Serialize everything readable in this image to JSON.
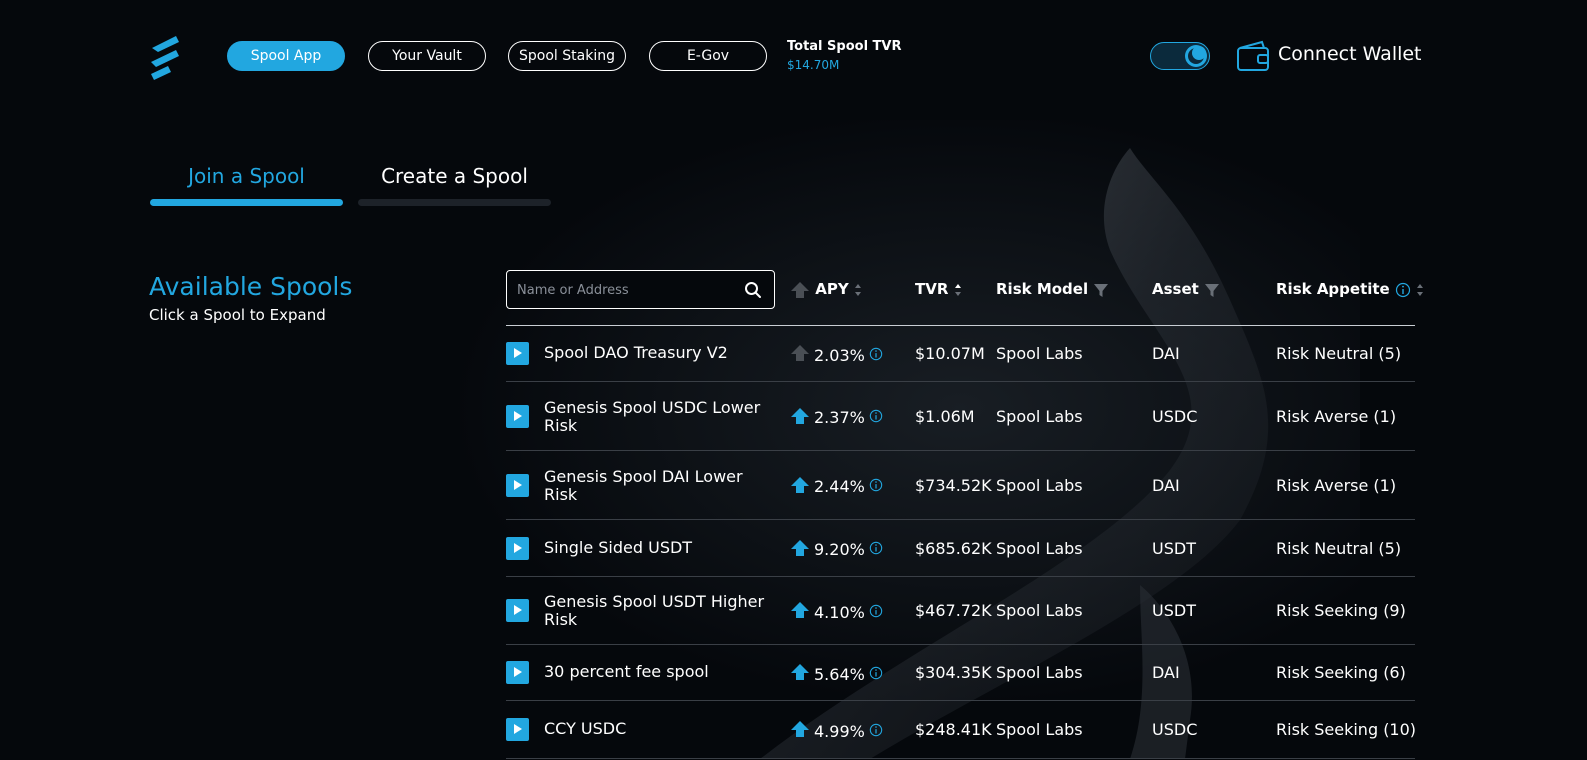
{
  "nav": {
    "items": [
      {
        "label": "Spool App",
        "active": true
      },
      {
        "label": "Your Vault",
        "active": false
      },
      {
        "label": "Spool Staking",
        "active": false
      },
      {
        "label": "E-Gov",
        "active": false
      }
    ],
    "tvr_label": "Total Spool TVR",
    "tvr_value": "$14.70M",
    "connect_wallet": "Connect Wallet"
  },
  "tabs": {
    "join": "Join a Spool",
    "create": "Create a Spool"
  },
  "available": {
    "title": "Available Spools",
    "subtitle": "Click a Spool to Expand"
  },
  "search": {
    "placeholder": "Name or Address"
  },
  "table": {
    "headers": {
      "apy": "APY",
      "tvr": "TVR",
      "risk_model": "Risk Model",
      "asset": "Asset",
      "risk_appetite": "Risk Appetite"
    },
    "rows": [
      {
        "name": "Spool DAO Treasury V2",
        "apy": "2.03%",
        "apy_trend": "neutral",
        "tvr": "$10.07M",
        "risk_model": "Spool Labs",
        "asset": "DAI",
        "risk_appetite": "Risk Neutral (5)"
      },
      {
        "name": "Genesis Spool USDC Lower Risk",
        "apy": "2.37%",
        "apy_trend": "up",
        "tvr": "$1.06M",
        "risk_model": "Spool Labs",
        "asset": "USDC",
        "risk_appetite": "Risk Averse (1)"
      },
      {
        "name": "Genesis Spool DAI Lower Risk",
        "apy": "2.44%",
        "apy_trend": "up",
        "tvr": "$734.52K",
        "risk_model": "Spool Labs",
        "asset": "DAI",
        "risk_appetite": "Risk Averse (1)"
      },
      {
        "name": "Single Sided USDT",
        "apy": "9.20%",
        "apy_trend": "up",
        "tvr": "$685.62K",
        "risk_model": "Spool Labs",
        "asset": "USDT",
        "risk_appetite": "Risk Neutral (5)"
      },
      {
        "name": "Genesis Spool USDT Higher Risk",
        "apy": "4.10%",
        "apy_trend": "up",
        "tvr": "$467.72K",
        "risk_model": "Spool Labs",
        "asset": "USDT",
        "risk_appetite": "Risk Seeking (9)"
      },
      {
        "name": "30 percent fee spool",
        "apy": "5.64%",
        "apy_trend": "up",
        "tvr": "$304.35K",
        "risk_model": "Spool Labs",
        "asset": "DAI",
        "risk_appetite": "Risk Seeking (6)"
      },
      {
        "name": "CCY USDC",
        "apy": "4.99%",
        "apy_trend": "up",
        "tvr": "$248.41K",
        "risk_model": "Spool Labs",
        "asset": "USDC",
        "risk_appetite": "Risk Seeking (10)"
      }
    ]
  },
  "colors": {
    "accent": "#22a7e0",
    "background": "#05080c",
    "neutral_arrow": "#4a4f55"
  }
}
